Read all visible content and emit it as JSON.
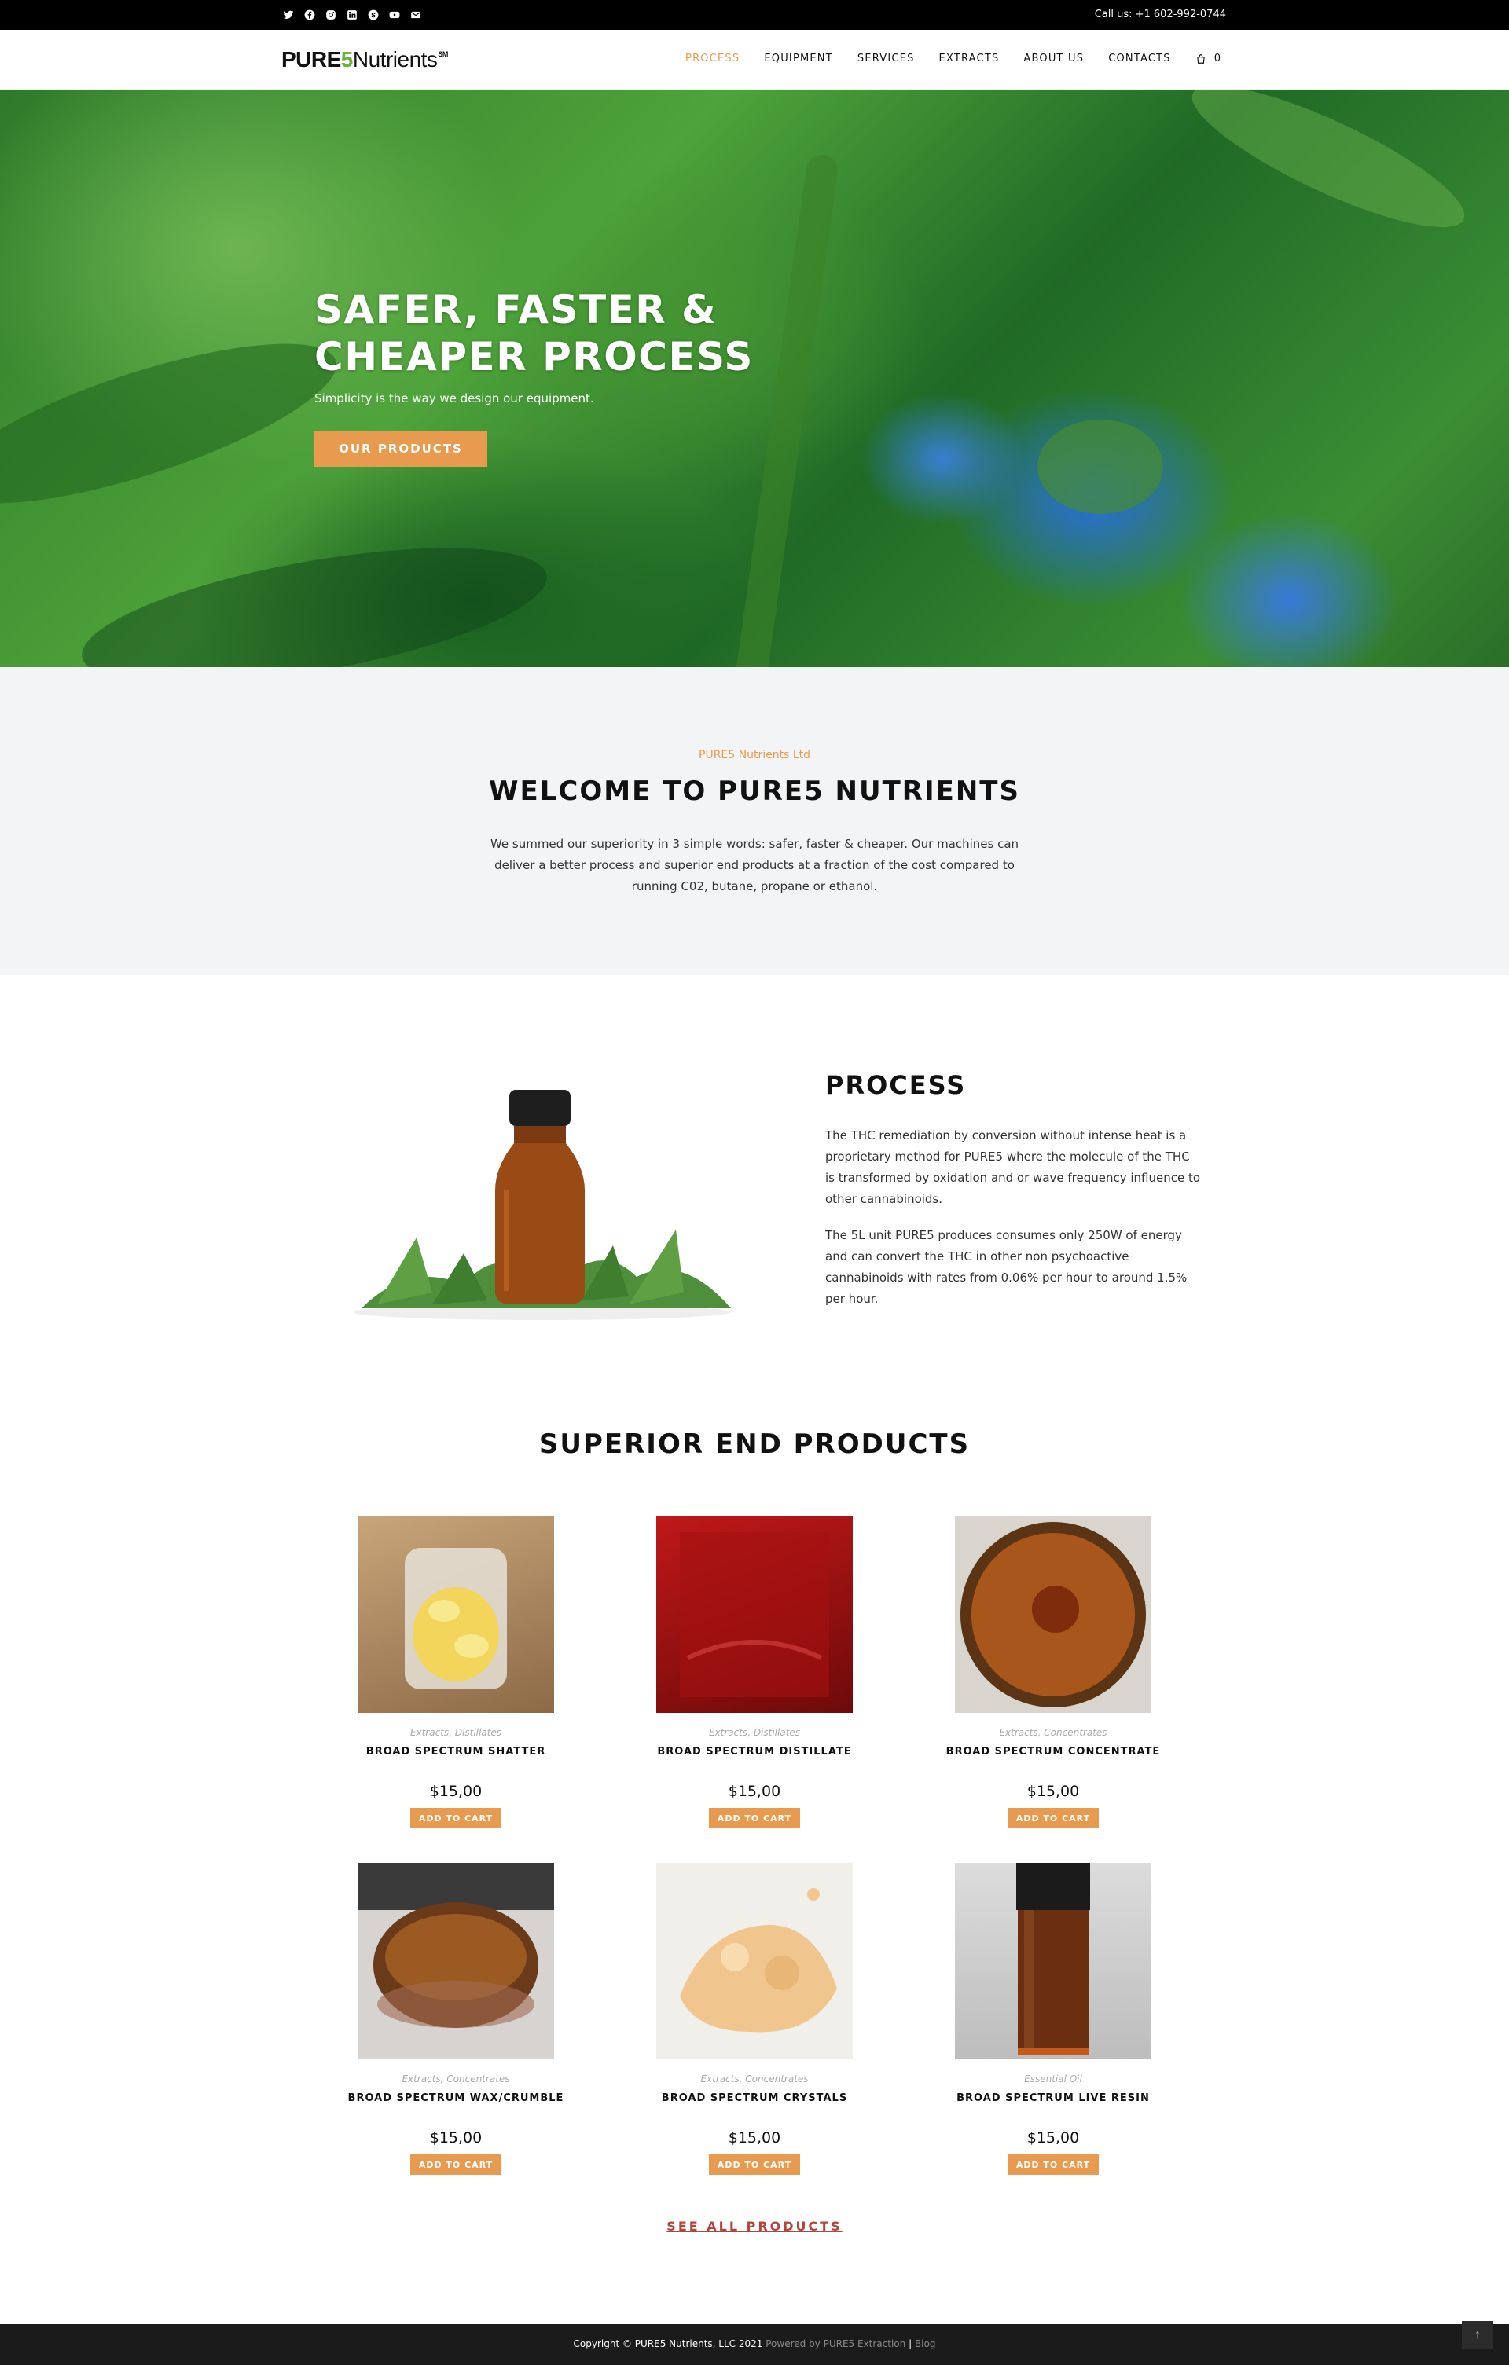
{
  "topbar": {
    "social_icons": [
      "twitter-icon",
      "facebook-icon",
      "instagram-icon",
      "linkedin-icon",
      "skype-icon",
      "youtube-icon",
      "envelope-icon"
    ],
    "call_us": "Call us: +1 602-992-0744"
  },
  "header": {
    "logo_bold": "PURE",
    "logo_five": "5",
    "logo_rest": "Nutrients",
    "logo_sm": "SM",
    "nav": [
      {
        "label": "PROCESS",
        "active": true
      },
      {
        "label": "EQUIPMENT",
        "active": false
      },
      {
        "label": "SERVICES",
        "active": false
      },
      {
        "label": "EXTRACTS",
        "active": false
      },
      {
        "label": "ABOUT US",
        "active": false
      },
      {
        "label": "CONTACTS",
        "active": false
      }
    ],
    "cart_count": "0"
  },
  "hero": {
    "title_line1": "SAFER, FASTER &",
    "title_line2": "CHEAPER PROCESS",
    "subtitle": "Simplicity is the way we design our equipment.",
    "button": "OUR PRODUCTS"
  },
  "welcome": {
    "eyebrow": "PURE5 Nutrients Ltd",
    "title": "WELCOME TO PURE5 NUTRIENTS",
    "text": "We summed our superiority in 3 simple words: safer, faster & cheaper. Our machines can deliver a better process and superior end products at a fraction of the cost compared to running C02, butane, propane or ethanol."
  },
  "process": {
    "title": "PROCESS",
    "p1": "The THC remediation by conversion without intense heat is a proprietary method for PURE5 where the molecule of the THC is transformed by oxidation and or wave frequency influence to other cannabinoids.",
    "p2": "The 5L unit PURE5 produces consumes only 250W of energy and can convert the THC in other non psychoactive cannabinoids with rates from 0.06% per hour to around 1.5% per hour."
  },
  "products": {
    "title": "SUPERIOR END PRODUCTS",
    "items": [
      {
        "cats": "Extracts, Distillates",
        "name": "BROAD SPECTRUM SHATTER",
        "price": "$15,00",
        "button": "ADD TO CART"
      },
      {
        "cats": "Extracts, Distillates",
        "name": "BROAD SPECTRUM DISTILLATE",
        "price": "$15,00",
        "button": "ADD TO CART"
      },
      {
        "cats": "Extracts, Concentrates",
        "name": "BROAD SPECTRUM CONCENTRATE",
        "price": "$15,00",
        "button": "ADD TO CART"
      },
      {
        "cats": "Extracts, Concentrates",
        "name": "BROAD SPECTRUM WAX/CRUMBLE",
        "price": "$15,00",
        "button": "ADD TO CART"
      },
      {
        "cats": "Extracts, Concentrates",
        "name": "BROAD SPECTRUM CRYSTALS",
        "price": "$15,00",
        "button": "ADD TO CART"
      },
      {
        "cats": "Essential Oil",
        "name": "BROAD SPECTRUM LIVE RESIN",
        "price": "$15,00",
        "button": "ADD TO CART"
      }
    ],
    "see_all": "SEE ALL PRODUCTS"
  },
  "footer": {
    "copyright": "Copyright © PURE5 Nutrients, LLC 2021",
    "powered": "Powered by PURE5 Extraction",
    "sep": "|",
    "blog": "Blog"
  },
  "colors": {
    "accent": "#e89a4e",
    "logo_green": "#6bb23c",
    "link_red": "#b0473f",
    "topbar": "#000000",
    "footer": "#1b1b1b"
  }
}
